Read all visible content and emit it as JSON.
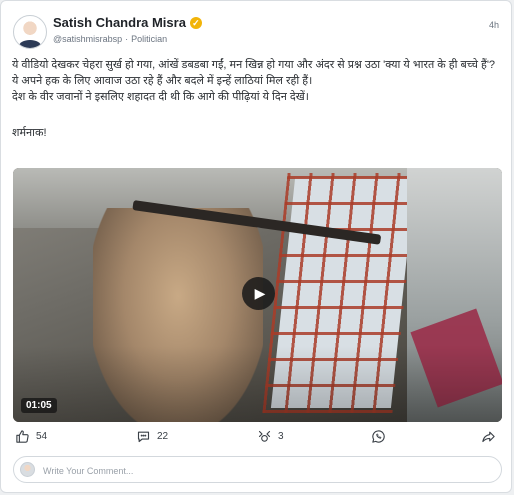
{
  "post": {
    "author_name": "Satish Chandra Misra",
    "handle": "@satishmisrabsp",
    "role": "Politician",
    "time": "4h",
    "text": [
      "ये वीडियो देखकर चेहरा सुर्ख हो गया, आंखें डबडबा गईं, मन खिन्न हो गया और अंदर से प्रश्न उठा 'क्या ये भारत के ही बच्चे हैं'?",
      "ये अपने हक के लिए आवाज उठा रहे हैं और बदले में इन्हें लाठियां मिल रही हैं।",
      "देश के वीर जवानों ने इसलिए शहादत दी थी कि आगे की पीढ़ियां ये दिन देखें।"
    ],
    "closing": "शर्मनाक!"
  },
  "video": {
    "duration": "01:05"
  },
  "actions": {
    "likes": "54",
    "comments": "22",
    "reposts": "3"
  },
  "comment_box": {
    "placeholder": "Write Your Comment..."
  },
  "colors": {
    "verified_badge": "#f2b409",
    "icon": "#3a4047",
    "text": "#2b2f33"
  }
}
